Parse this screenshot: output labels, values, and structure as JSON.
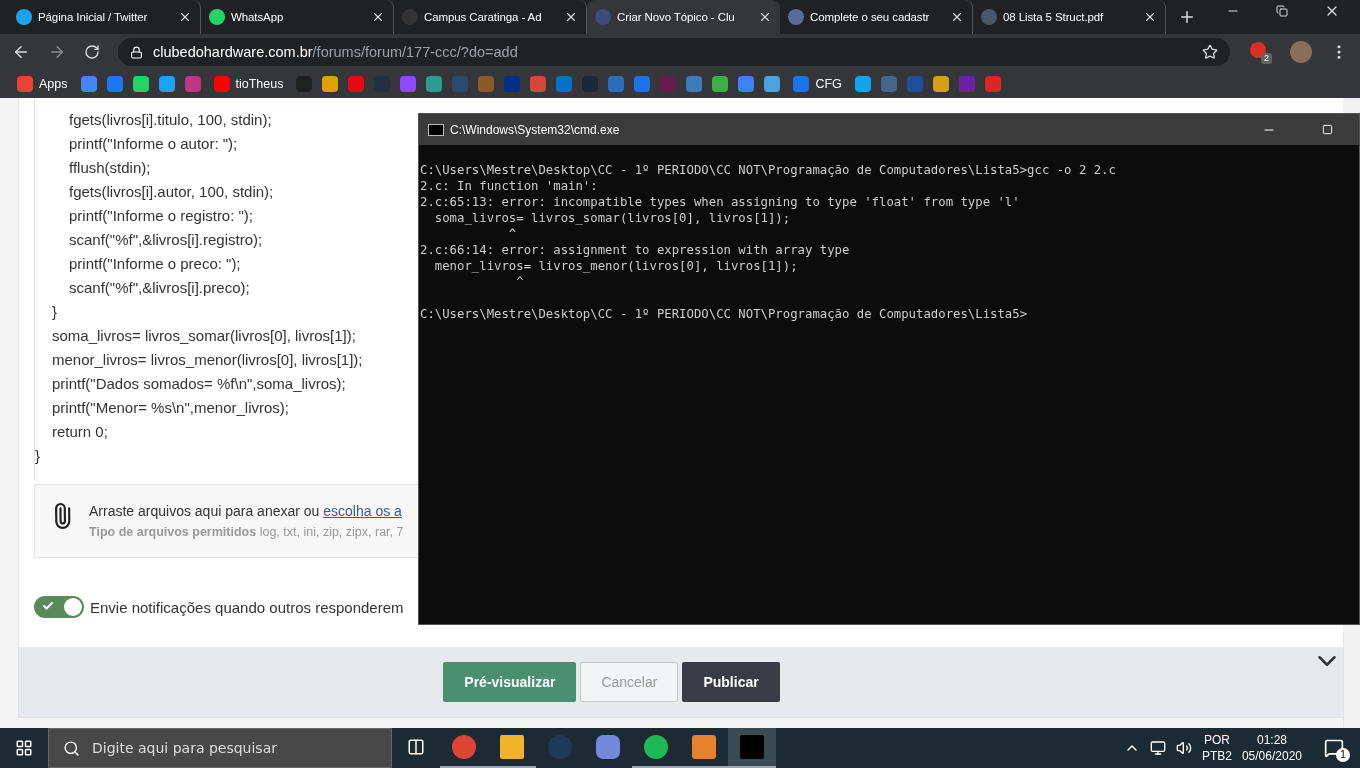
{
  "browser": {
    "tabs": [
      {
        "title": "Página Inicial / Twitter",
        "color": "#1da1f2",
        "selected": false
      },
      {
        "title": "WhatsApp",
        "color": "#25d366",
        "selected": false
      },
      {
        "title": "Campus Caratinga - Ad",
        "color": "#333333",
        "selected": false
      },
      {
        "title": "Criar Novo Tópico - Clu",
        "color": "#3d4a7a",
        "selected": true
      },
      {
        "title": "Complete o seu cadastr",
        "color": "#5a6a9a",
        "selected": false
      },
      {
        "title": "08 Lista 5 Struct.pdf",
        "color": "#4a5568",
        "selected": false
      }
    ],
    "url": {
      "domain": "clubedohardware.com.br",
      "path": "/forums/forum/177-ccc/?do=add"
    },
    "extension_badge": "2",
    "bookmarks": [
      {
        "label": "Apps",
        "color": "#ea4335"
      },
      {
        "color": "#4285f4"
      },
      {
        "color": "#1877f2"
      },
      {
        "color": "#25d366"
      },
      {
        "color": "#1da1f2"
      },
      {
        "color": "#c13584"
      },
      {
        "label": "tioTheus",
        "color": "#ff0000"
      },
      {
        "color": "#222222"
      },
      {
        "color": "#e0a000"
      },
      {
        "color": "#e50914"
      },
      {
        "color": "#232f3e"
      },
      {
        "color": "#9146ff"
      },
      {
        "color": "#2a9d8f"
      },
      {
        "color": "#2b4a6f"
      },
      {
        "color": "#8b5a2b"
      },
      {
        "color": "#003087"
      },
      {
        "color": "#d44638"
      },
      {
        "color": "#0072c6"
      },
      {
        "color": "#1b2838"
      },
      {
        "color": "#2a6ebb"
      },
      {
        "color": "#1a73e8"
      },
      {
        "color": "#6a1b4d"
      },
      {
        "color": "#3d7ab8"
      },
      {
        "color": "#3cb043"
      },
      {
        "color": "#3b82f6"
      },
      {
        "color": "#4aa3df"
      },
      {
        "label": "CFG",
        "color": "#1a73e8"
      },
      {
        "color": "#0ea5e9"
      },
      {
        "color": "#446688"
      },
      {
        "color": "#1e4e9c"
      },
      {
        "color": "#d4a017"
      },
      {
        "color": "#6b21a8"
      },
      {
        "color": "#dc2626"
      }
    ]
  },
  "editor": {
    "code": [
      {
        "children": [
          {
            "children": [
              {
                "text": "fgets(livros[i].titulo, 100, stdin);"
              },
              {
                "text": "printf(\"Informe o autor: \");"
              },
              {
                "text": "fflush(stdin);"
              },
              {
                "text": "fgets(livros[i].autor, 100, stdin);"
              },
              {
                "text": "printf(\"Informe o registro: \");"
              },
              {
                "text": "scanf(\"%f\",&livros[i].registro);"
              },
              {
                "text": "printf(\"Informe o preco: \");"
              },
              {
                "text": "scanf(\"%f\",&livros[i].preco);"
              }
            ]
          },
          {
            "text": "}"
          },
          {
            "text": "soma_livros= livros_somar(livros[0], livros[1]);"
          },
          {
            "text": "menor_livros= livros_menor(livros[0], livros[1]);"
          },
          {
            "text": "printf(\"Dados somados= %f\\n\",soma_livros);"
          },
          {
            "text": "printf(\"Menor= %s\\n\",menor_livros);"
          },
          {
            "text": "return 0;"
          }
        ]
      },
      {
        "text": "}"
      }
    ]
  },
  "attachments": {
    "text": "Arraste arquivos aqui para anexar ou ",
    "link": "escolha os a",
    "types_label": "Tipo de arquivos permitidos",
    "types": "log, txt, ini, zip, zipx, rar, 7"
  },
  "notify": {
    "label": "Envie notificações quando outros responderem",
    "on": true
  },
  "buttons": [
    {
      "label": "Pré-visualizar",
      "kind": "primary"
    },
    {
      "label": "Cancelar",
      "kind": "outline"
    },
    {
      "label": "Publicar",
      "kind": "dark"
    }
  ],
  "terminal": {
    "title": "C:\\Windows\\System32\\cmd.exe",
    "blocks": [
      [
        "C:\\Users\\Mestre\\Desktop\\CC - 1º PERIODO\\CC NOT\\Programação de Computadores\\Lista5>gcc -o 2 2.c",
        "2.c: In function 'main':",
        "2.c:65:13: error: incompatible types when assigning to type 'float' from type 'l'",
        "  soma_livros= livros_somar(livros[0], livros[1]);",
        "            ^",
        "2.c:66:14: error: assignment to expression with array type",
        "  menor_livros= livros_menor(livros[0], livros[1]);",
        "             ^"
      ],
      [
        "C:\\Users\\Mestre\\Desktop\\CC - 1º PERIODO\\CC NOT\\Programação de Computadores\\Lista5>"
      ]
    ]
  },
  "taskbar": {
    "search": {
      "placeholder": "Digite aqui para pesquisar"
    },
    "apps": [
      {
        "kind": "chrome",
        "running": true,
        "selected": false
      },
      {
        "kind": "folder",
        "running": true,
        "selected": false
      },
      {
        "kind": "steam",
        "running": false,
        "selected": false
      },
      {
        "kind": "discord",
        "running": false,
        "selected": false
      },
      {
        "kind": "spotify",
        "running": true,
        "selected": false
      },
      {
        "kind": "sublime",
        "running": true,
        "selected": false
      },
      {
        "kind": "terminal",
        "running": true,
        "selected": true
      }
    ],
    "language": [
      "POR",
      "PTB2"
    ],
    "time": "01:28",
    "date": "05/06/2020",
    "notifications": "1"
  }
}
